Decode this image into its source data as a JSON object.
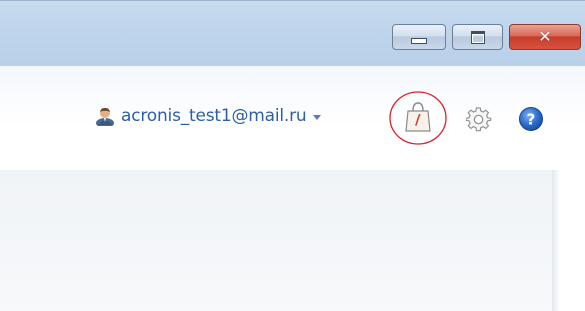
{
  "window": {
    "buttons": {
      "minimize": "minimize",
      "maximize": "maximize",
      "close": "close"
    }
  },
  "toolbar": {
    "account_email": "acronis_test1@mail.ru",
    "icons": [
      "user-icon",
      "chevron-down-icon",
      "shopping-bag-icon",
      "gear-icon",
      "help-icon"
    ],
    "highlight_color": "#d9232e",
    "accent_color": "#2d5ea7"
  }
}
